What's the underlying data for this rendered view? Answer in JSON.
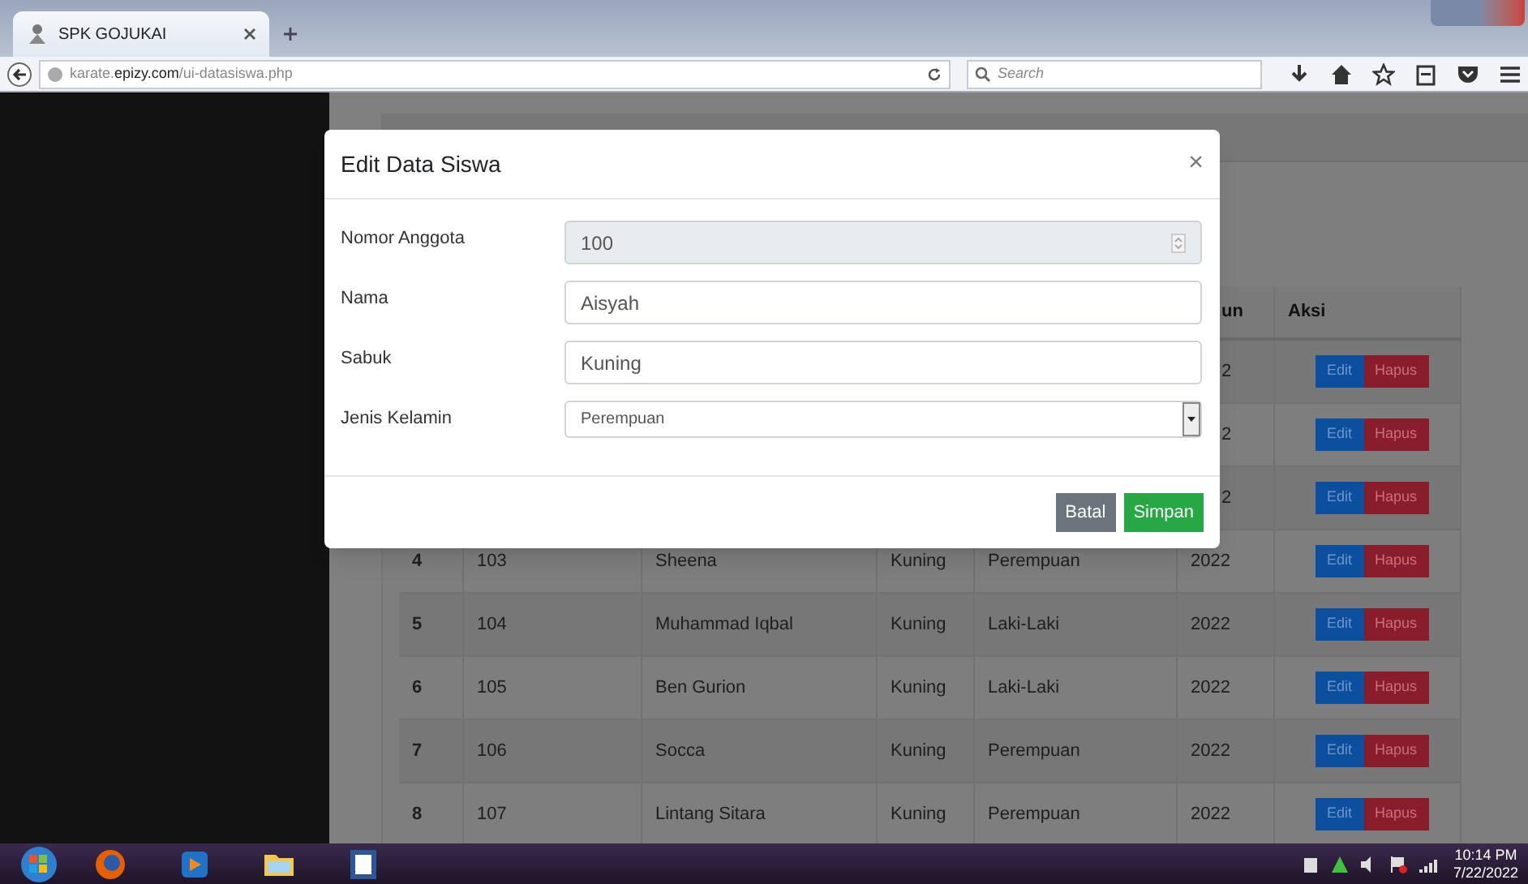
{
  "browser": {
    "tab_title": "SPK GOJUKAI",
    "url": "karate.**epizy.com**/ui-datasiswa.php",
    "search_placeholder": "Search"
  },
  "table": {
    "columns": [
      {
        "label": "un"
      },
      {
        "label": "Aksi"
      }
    ],
    "rows": [
      {
        "kind": "covered",
        "tahun": "2",
        "actions": [
          "Edit",
          "Hapus"
        ]
      },
      {
        "kind": "covered",
        "tahun": "2",
        "actions": [
          "Edit",
          "Hapus"
        ]
      },
      {
        "kind": "covered",
        "tahun": "2",
        "actions": [
          "Edit",
          "Hapus"
        ]
      },
      {
        "kind": "full",
        "no": "4",
        "nomor": "103",
        "nama": "Sheena",
        "sabuk": "Kuning",
        "jenis_kelamin": "Perempuan",
        "tahun": "2022",
        "actions": [
          "Edit",
          "Hapus"
        ]
      },
      {
        "kind": "full",
        "no": "5",
        "nomor": "104",
        "nama": "Muhammad Iqbal",
        "sabuk": "Kuning",
        "jenis_kelamin": "Laki-Laki",
        "tahun": "2022",
        "actions": [
          "Edit",
          "Hapus"
        ]
      },
      {
        "kind": "full",
        "no": "6",
        "nomor": "105",
        "nama": "Ben Gurion",
        "sabuk": "Kuning",
        "jenis_kelamin": "Laki-Laki",
        "tahun": "2022",
        "actions": [
          "Edit",
          "Hapus"
        ]
      },
      {
        "kind": "full",
        "no": "7",
        "nomor": "106",
        "nama": "Socca",
        "sabuk": "Kuning",
        "jenis_kelamin": "Perempuan",
        "tahun": "2022",
        "actions": [
          "Edit",
          "Hapus"
        ]
      },
      {
        "kind": "full",
        "no": "8",
        "nomor": "107",
        "nama": "Lintang Sitara",
        "sabuk": "Kuning",
        "jenis_kelamin": "Perempuan",
        "tahun": "2022",
        "actions": [
          "Edit",
          "Hapus"
        ]
      }
    ]
  },
  "modal": {
    "title": "Edit Data Siswa",
    "close": "×",
    "fields": [
      {
        "label": "Nomor Anggota",
        "kind": "number",
        "value": "100",
        "disabled": true
      },
      {
        "label": "Nama",
        "kind": "text",
        "value": "Aisyah",
        "disabled": false
      },
      {
        "label": "Sabuk",
        "kind": "text",
        "value": "Kuning",
        "disabled": false
      },
      {
        "label": "Jenis Kelamin",
        "kind": "select",
        "value": "Perempuan",
        "disabled": false
      }
    ],
    "buttons": [
      {
        "label": "Batal",
        "kind": "secondary"
      },
      {
        "label": "Simpan",
        "kind": "primary"
      }
    ]
  },
  "taskbar": {
    "time": "10:14 PM",
    "date": "7/22/2022"
  }
}
